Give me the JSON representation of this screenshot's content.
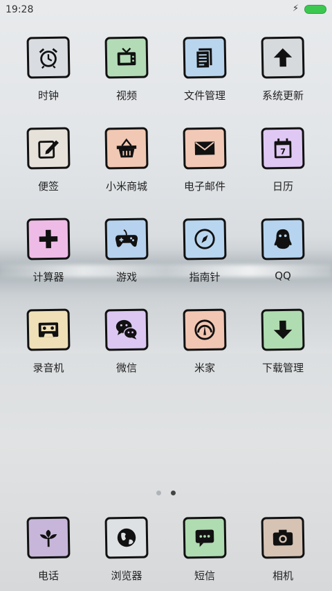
{
  "status_bar": {
    "time": "19:28"
  },
  "apps": [
    {
      "label": "时钟",
      "icon": "alarm-clock-icon",
      "color": "#d9dde2"
    },
    {
      "label": "视频",
      "icon": "tv-icon",
      "color": "#b3dcb6"
    },
    {
      "label": "文件管理",
      "icon": "document-icon",
      "color": "#b9d5ee"
    },
    {
      "label": "系统更新",
      "icon": "arrow-up-icon",
      "color": "#d7dadd"
    },
    {
      "label": "便签",
      "icon": "edit-note-icon",
      "color": "#e6e2da"
    },
    {
      "label": "小米商城",
      "icon": "shopping-basket-icon",
      "color": "#f1c8b3"
    },
    {
      "label": "电子邮件",
      "icon": "envelope-icon",
      "color": "#f2c9b7"
    },
    {
      "label": "日历",
      "icon": "calendar-icon",
      "color": "#e0c8f4"
    },
    {
      "label": "计算器",
      "icon": "plus-icon",
      "color": "#eebbe6"
    },
    {
      "label": "游戏",
      "icon": "gamepad-icon",
      "color": "#b6d2ee"
    },
    {
      "label": "指南针",
      "icon": "compass-icon",
      "color": "#b9d6f0"
    },
    {
      "label": "QQ",
      "icon": "penguin-icon",
      "color": "#b6d4ef"
    },
    {
      "label": "录音机",
      "icon": "cassette-icon",
      "color": "#efe0b8"
    },
    {
      "label": "微信",
      "icon": "wechat-icon",
      "color": "#dbc7f2"
    },
    {
      "label": "米家",
      "icon": "gauge-icon",
      "color": "#f1c6b2"
    },
    {
      "label": "下载管理",
      "icon": "arrow-down-icon",
      "color": "#afdcb0"
    }
  ],
  "calendar_day": "7",
  "pager": {
    "pages": 2,
    "active": 2
  },
  "dock": [
    {
      "label": "电话",
      "icon": "leaf-icon",
      "color": "#c7b6da"
    },
    {
      "label": "浏览器",
      "icon": "globe-icon",
      "color": "#dde1e4"
    },
    {
      "label": "短信",
      "icon": "chat-bubble-icon",
      "color": "#afdcb0"
    },
    {
      "label": "相机",
      "icon": "camera-icon",
      "color": "#d7c3b4"
    }
  ]
}
